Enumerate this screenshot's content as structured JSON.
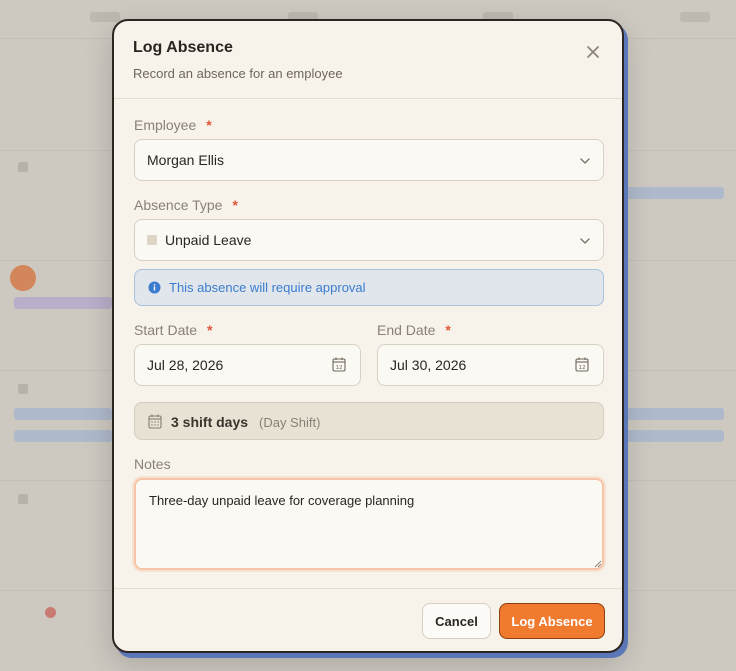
{
  "dialog": {
    "title": "Log Absence",
    "subtitle": "Record an absence for an employee"
  },
  "employee": {
    "label": "Employee",
    "required_mark": "*",
    "value": "Morgan Ellis"
  },
  "absence_type": {
    "label": "Absence Type",
    "required_mark": "*",
    "value": "Unpaid Leave",
    "swatch_color": "#ddd6c2"
  },
  "approval_notice": "This absence will require approval",
  "start_date": {
    "label": "Start Date",
    "required_mark": "*",
    "value": "Jul 28, 2026"
  },
  "end_date": {
    "label": "End Date",
    "required_mark": "*",
    "value": "Jul 30, 2026"
  },
  "shift_summary": {
    "count": "3 shift days",
    "type": "(Day Shift)"
  },
  "notes": {
    "label": "Notes",
    "value": "Three-day unpaid leave for coverage planning"
  },
  "actions": {
    "cancel": "Cancel",
    "submit": "Log Absence"
  },
  "colors": {
    "accent": "#f07a2e",
    "required": "#e0553b",
    "info": "#3b7ccf"
  }
}
